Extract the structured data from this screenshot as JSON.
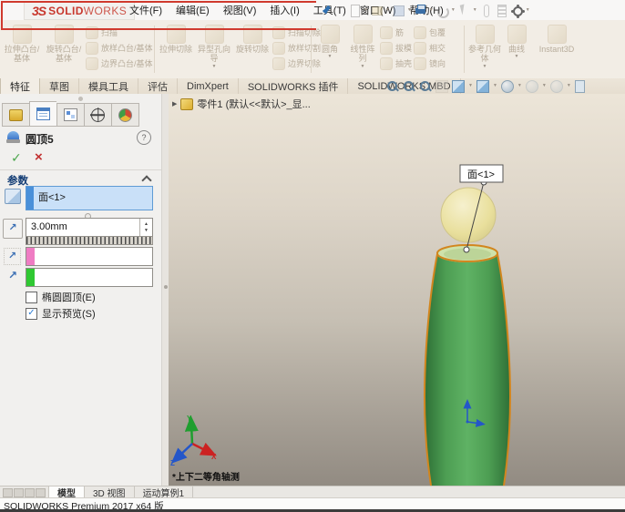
{
  "titlebar": {
    "logo_mark": "3S",
    "logo_bold": "SOLID",
    "logo_light": "WORKS",
    "menus": [
      "文件(F)",
      "编辑(E)",
      "视图(V)",
      "插入(I)",
      "工具(T)",
      "窗口(W)",
      "帮助(H)"
    ]
  },
  "glyphs": {
    "dropdown": "▼",
    "spin_up": "▲",
    "spin_down": "▼",
    "check": "✓",
    "cross": "×",
    "help": "?",
    "tree_arrow": "▶",
    "arrow_ne": "↗"
  },
  "ribbon": {
    "group1": {
      "big": [
        "拉伸凸台/基体",
        "旋转凸台/基体"
      ],
      "small": [
        "扫描",
        "放样凸台/基体",
        "边界凸台/基体"
      ]
    },
    "group2": {
      "big": [
        "拉伸切除",
        "异型孔向导",
        "旋转切除"
      ],
      "small": [
        "扫描切除",
        "放样切割",
        "边界切除"
      ]
    },
    "group3": {
      "big": [
        "圆角",
        "线性阵列"
      ],
      "small_a": [
        "筋",
        "拔模",
        "抽壳"
      ],
      "small_b": [
        "包覆",
        "相交",
        "镜向"
      ]
    },
    "group4": {
      "big": [
        "参考几何体",
        "曲线"
      ],
      "instant3d": "Instant3D"
    }
  },
  "command_tabs": {
    "items": [
      "特征",
      "草图",
      "模具工具",
      "评估",
      "DimXpert",
      "SOLIDWORKS 插件",
      "SOLIDWORKS MBD"
    ],
    "active": "特征"
  },
  "property_panel": {
    "title": "圆顶5",
    "params_header": "参数",
    "face_value": "面<1>",
    "distance_value": "3.00mm",
    "ellipse_label": "椭圆圆顶(E)",
    "preview_label": "显示预览(S)",
    "ellipse_checked": false,
    "preview_checked": true
  },
  "viewport": {
    "tree_label": "零件1 (默认<<默认>_显...",
    "callout_label": "面<1>",
    "view_label": "*上下二等角轴测",
    "axis_x": "X",
    "axis_y": "Y",
    "axis_z": "Z"
  },
  "bottom": {
    "tabs": [
      "模型",
      "3D 视图",
      "运动算例1"
    ],
    "active_tab": "模型",
    "status": "SOLIDWORKS Premium 2017 x64 版"
  },
  "colors": {
    "logo_red": "#c8372d",
    "edge_orange": "#d2861e",
    "bottle_green": "#4d9e53",
    "selection_blue": "#c9e0f8",
    "swatch_pink": "#ef7cc3",
    "swatch_green": "#2fc832"
  }
}
